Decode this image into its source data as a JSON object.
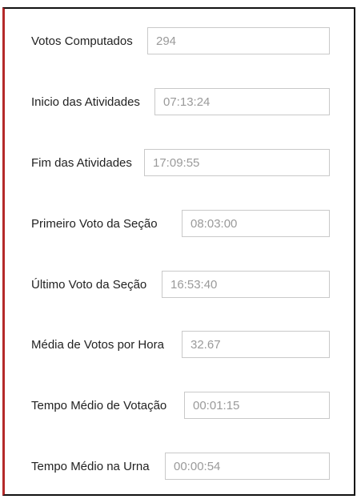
{
  "stats": [
    {
      "label": "Votos Computados",
      "value": "294"
    },
    {
      "label": "Inicio das Atividades",
      "value": "07:13:24"
    },
    {
      "label": "Fim das Atividades",
      "value": "17:09:55"
    },
    {
      "label": "Primeiro Voto da Seção",
      "value": "08:03:00"
    },
    {
      "label": "Último Voto da Seção",
      "value": "16:53:40"
    },
    {
      "label": "Média de Votos por Hora",
      "value": "32.67"
    },
    {
      "label": "Tempo Médio de Votação",
      "value": "00:01:15"
    },
    {
      "label": "Tempo Médio na Urna",
      "value": "00:00:54"
    }
  ],
  "colors": {
    "accent_border": "#b52a2a",
    "frame_border": "#111111",
    "field_border": "#c9c9c9",
    "field_text": "#9a9a9a",
    "label_text": "#222222"
  }
}
